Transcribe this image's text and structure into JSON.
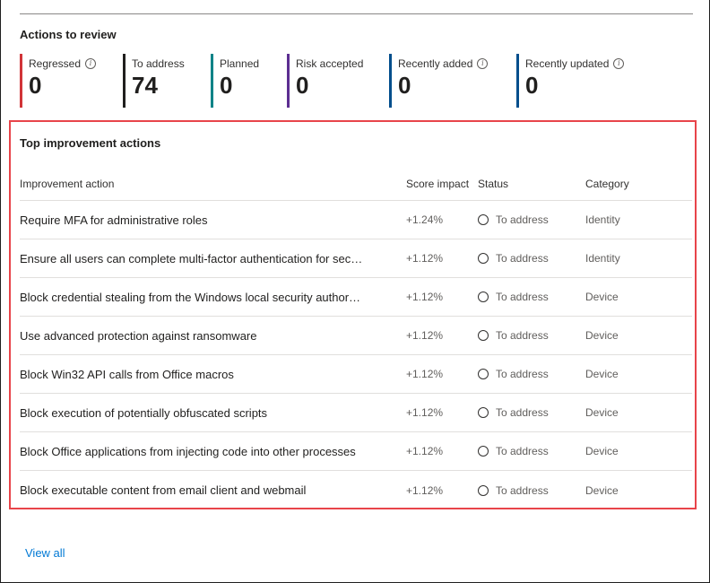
{
  "actions_to_review": {
    "title": "Actions to review",
    "metrics": [
      {
        "label": "Regressed",
        "value": "0",
        "color": "#d13438",
        "info": true
      },
      {
        "label": "To address",
        "value": "74",
        "color": "#201f1e",
        "info": false
      },
      {
        "label": "Planned",
        "value": "0",
        "color": "#038387",
        "info": false
      },
      {
        "label": "Risk accepted",
        "value": "0",
        "color": "#5c2e91",
        "info": false
      },
      {
        "label": "Recently added",
        "value": "0",
        "color": "#004e8c",
        "info": true
      },
      {
        "label": "Recently updated",
        "value": "0",
        "color": "#004e8c",
        "info": true
      }
    ]
  },
  "top_actions": {
    "title": "Top improvement actions",
    "columns": {
      "action": "Improvement action",
      "score": "Score impact",
      "status": "Status",
      "category": "Category"
    },
    "rows": [
      {
        "action": "Require MFA for administrative roles",
        "score": "+1.24%",
        "status": "To address",
        "category": "Identity"
      },
      {
        "action": "Ensure all users can complete multi-factor authentication for sec…",
        "score": "+1.12%",
        "status": "To address",
        "category": "Identity"
      },
      {
        "action": "Block credential stealing from the Windows local security author…",
        "score": "+1.12%",
        "status": "To address",
        "category": "Device"
      },
      {
        "action": "Use advanced protection against ransomware",
        "score": "+1.12%",
        "status": "To address",
        "category": "Device"
      },
      {
        "action": "Block Win32 API calls from Office macros",
        "score": "+1.12%",
        "status": "To address",
        "category": "Device"
      },
      {
        "action": "Block execution of potentially obfuscated scripts",
        "score": "+1.12%",
        "status": "To address",
        "category": "Device"
      },
      {
        "action": "Block Office applications from injecting code into other processes",
        "score": "+1.12%",
        "status": "To address",
        "category": "Device"
      },
      {
        "action": "Block executable content from email client and webmail",
        "score": "+1.12%",
        "status": "To address",
        "category": "Device"
      }
    ]
  },
  "view_all_label": "View all",
  "colors": {
    "highlight_border": "#e8444a",
    "link": "#0078d4"
  }
}
